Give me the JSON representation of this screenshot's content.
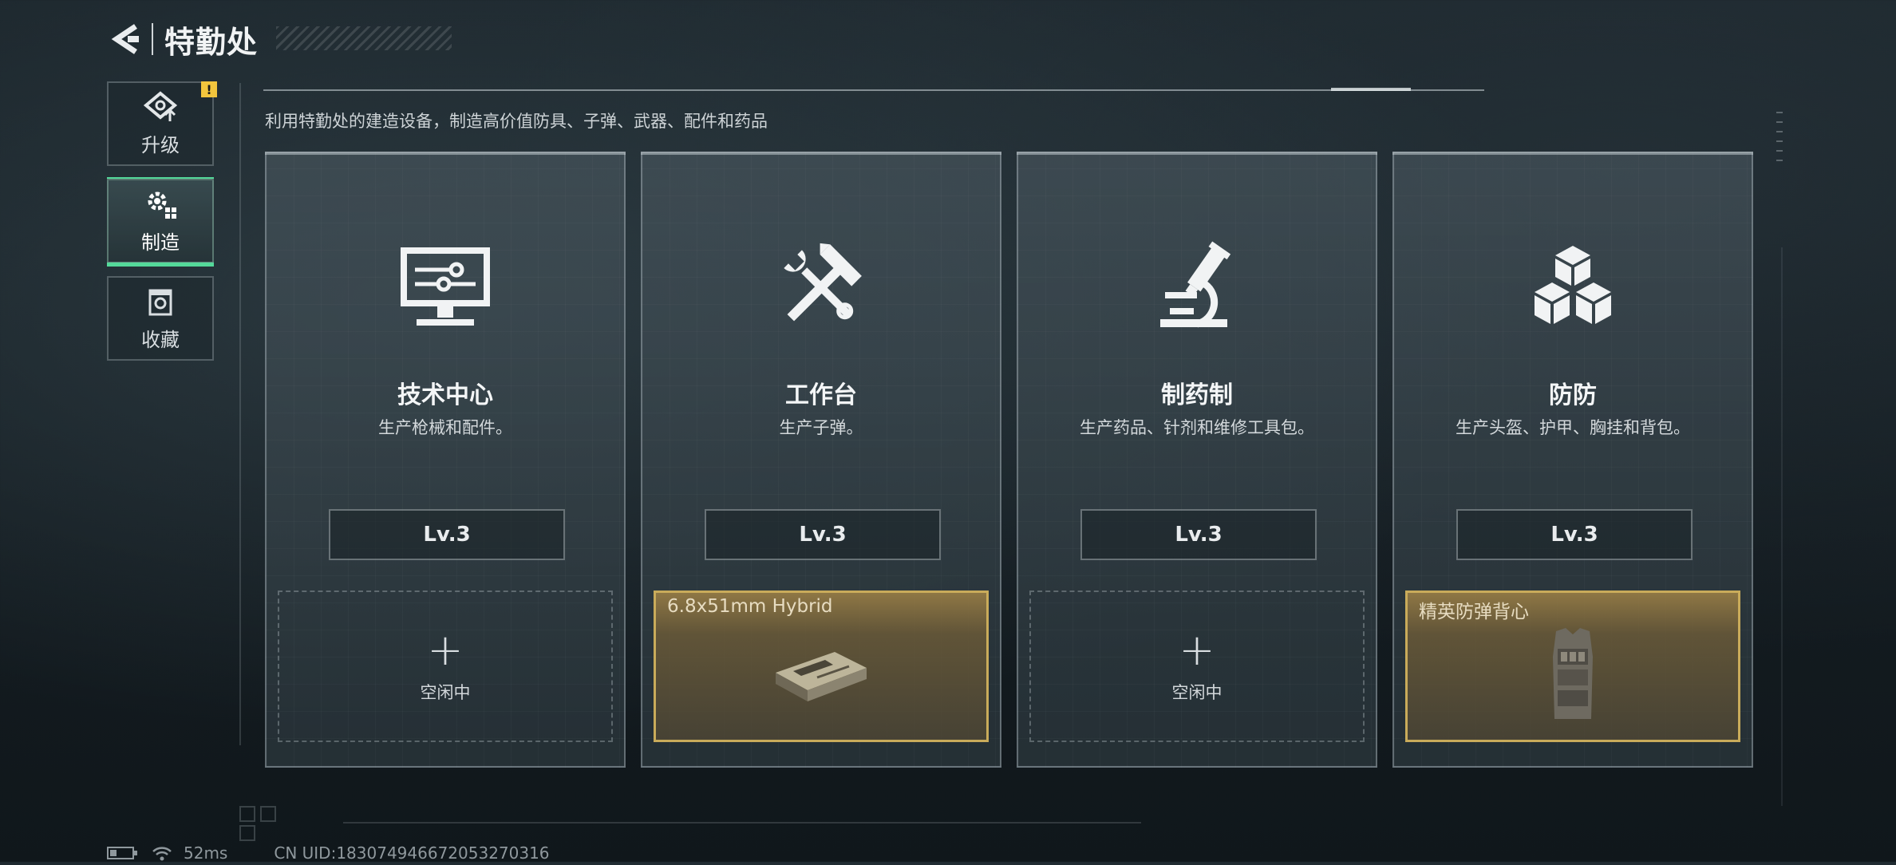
{
  "header": {
    "title": "特勤处"
  },
  "sidebar": {
    "items": [
      {
        "label": "升级",
        "icon": "upgrade-icon",
        "badge": "!"
      },
      {
        "label": "制造",
        "icon": "gear-icon",
        "active": true
      },
      {
        "label": "收藏",
        "icon": "collection-icon"
      }
    ]
  },
  "subtitle": "利用特勤处的建造设备，制造高价值防具、子弹、武器、配件和药品",
  "cards": [
    {
      "name": "技术中心",
      "desc": "生产枪械和配件。",
      "level": "Lv.3",
      "icon": "monitor-icon",
      "slot": {
        "state": "empty",
        "plus": "+",
        "label": "空闲中"
      }
    },
    {
      "name": "工作台",
      "desc": "生产子弹。",
      "level": "Lv.3",
      "icon": "hammer-wrench-icon",
      "slot": {
        "state": "producing",
        "item": "6.8x51mm Hybrid"
      }
    },
    {
      "name": "制药制",
      "desc": "生产药品、针剂和维修工具包。",
      "level": "Lv.3",
      "icon": "microscope-icon",
      "slot": {
        "state": "empty",
        "plus": "+",
        "label": "空闲中"
      }
    },
    {
      "name": "防防",
      "desc": "生产头盔、护甲、胸挂和背包。",
      "level": "Lv.3",
      "icon": "cubes-icon",
      "slot": {
        "state": "producing",
        "item": "精英防弹背心"
      }
    }
  ],
  "status": {
    "ping": "52ms",
    "uid": "CN UID:1830749466720532703​16"
  },
  "colors": {
    "accent": "#54d99a",
    "warning": "#f2c53d",
    "gold": "#c9ab5a"
  }
}
